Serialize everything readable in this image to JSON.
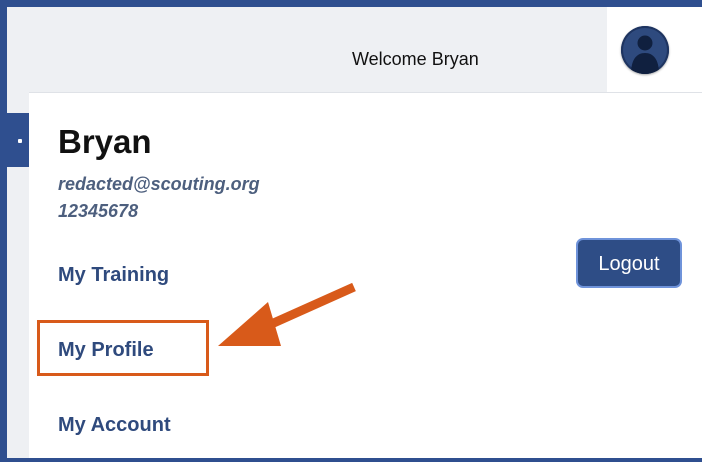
{
  "header": {
    "welcome_text": "Welcome Bryan"
  },
  "profile": {
    "name": "Bryan",
    "email": "redacted@scouting.org",
    "member_id": "12345678"
  },
  "menu": {
    "items": [
      {
        "label": "My Training"
      },
      {
        "label": "My Profile"
      },
      {
        "label": "My Account"
      }
    ]
  },
  "buttons": {
    "logout_label": "Logout"
  },
  "colors": {
    "brand_blue": "#2f4f8f",
    "link_blue": "#2f4a7d",
    "annotation_orange": "#d85a1a"
  },
  "icons": {
    "avatar": "user-avatar-icon",
    "annotation": "arrow-icon"
  }
}
